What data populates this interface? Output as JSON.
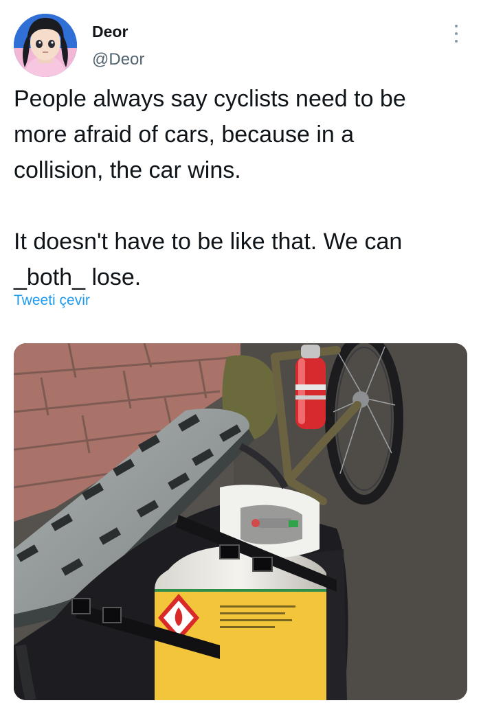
{
  "tweet": {
    "author": {
      "display_name": "Deor",
      "handle": "@Deor",
      "avatar_icon": "anime-avatar-icon"
    },
    "more_icon": "more-vertical-icon",
    "paragraphs": [
      "People always say cyclists need to be\nmore afraid of cars, because in a\ncollision, the car wins.",
      "It doesn't have to be like that. We can\n_both_ lose."
    ],
    "translate_label": "Tweeti çevir",
    "media": {
      "type": "photo"
    }
  },
  "colors": {
    "link": "#1d9bf0",
    "secondary_text": "#536471",
    "primary_text": "#0f1419"
  }
}
